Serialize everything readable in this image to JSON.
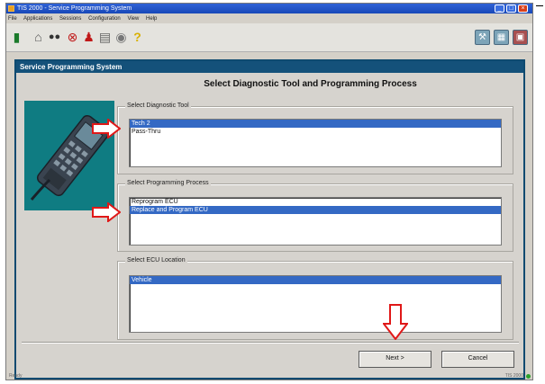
{
  "window": {
    "title": "TIS 2000 - Service Programming System",
    "menu": [
      "File",
      "Applications",
      "Sessions",
      "Configuration",
      "View",
      "Help"
    ]
  },
  "toolbar": {
    "left_icons": [
      "exit-icon",
      "home-icon",
      "search-icon",
      "stop-icon",
      "person-icon",
      "printer-icon",
      "disc-icon",
      "help-icon"
    ],
    "right_icons": [
      "tool-icon",
      "document-icon",
      "settings-icon"
    ]
  },
  "panel": {
    "header": "Service Programming System",
    "heading": "Select Diagnostic Tool and Programming Process"
  },
  "diagnostic_tool": {
    "label": "Select Diagnostic Tool",
    "items": [
      "Tech 2",
      "Pass-Thru"
    ],
    "selected": "Tech 2"
  },
  "programming_process": {
    "label": "Select Programming Process",
    "items": [
      "Reprogram ECU",
      "Replace and Program ECU"
    ],
    "selected": "Replace and Program ECU"
  },
  "ecu_location": {
    "label": "Select ECU Location",
    "items": [
      "Vehicle"
    ],
    "selected": "Vehicle"
  },
  "buttons": {
    "next": "Next >",
    "cancel": "Cancel"
  },
  "status": {
    "left": "Ready",
    "right": "TIS 2000"
  },
  "colors": {
    "header": "#14517a",
    "selection": "#3469c4",
    "arrow": "#e01818",
    "device_bg": "#0f7c82"
  }
}
